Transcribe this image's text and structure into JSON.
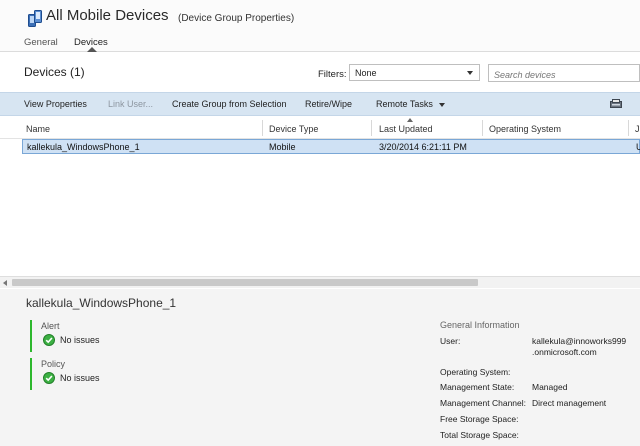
{
  "header": {
    "title": "All Mobile Devices",
    "subtitle": "(Device Group Properties)",
    "tabs": [
      {
        "label": "General",
        "active": false
      },
      {
        "label": "Devices",
        "active": true
      }
    ]
  },
  "section": {
    "title": "Devices (1)",
    "filters_label": "Filters:",
    "filter_value": "None",
    "search_placeholder": "Search devices"
  },
  "toolbar": {
    "view_properties": "View Properties",
    "link_user": "Link User...",
    "create_group": "Create Group from Selection",
    "retire_wipe": "Retire/Wipe",
    "remote_tasks": "Remote Tasks"
  },
  "grid": {
    "columns": [
      "Name",
      "Device Type",
      "Last Updated",
      "Operating System",
      "J"
    ],
    "rows": [
      [
        "kallekula_WindowsPhone_1",
        "Mobile",
        "3/20/2014 6:21:11 PM",
        "",
        "U"
      ]
    ]
  },
  "details": {
    "device_name": "kallekula_WindowsPhone_1",
    "alert": {
      "label": "Alert",
      "value": "No issues"
    },
    "policy": {
      "label": "Policy",
      "value": "No issues"
    },
    "general_info": {
      "title": "General Information",
      "user_label": "User:",
      "user_value_1": "kallekula@innoworks999",
      "user_value_2": ".onmicrosoft.com",
      "os_label": "Operating System:",
      "os_value": "",
      "mgmt_state_label": "Management State:",
      "mgmt_state_value": "Managed",
      "mgmt_channel_label": "Management Channel:",
      "mgmt_channel_value": "Direct management",
      "free_storage_label": "Free Storage Space:",
      "total_storage_label": "Total Storage Space:"
    }
  },
  "colors": {
    "toolbar_bg": "#d7e5f2",
    "selection_bg": "#cfe1f4",
    "status_ok": "#2eb82e"
  }
}
